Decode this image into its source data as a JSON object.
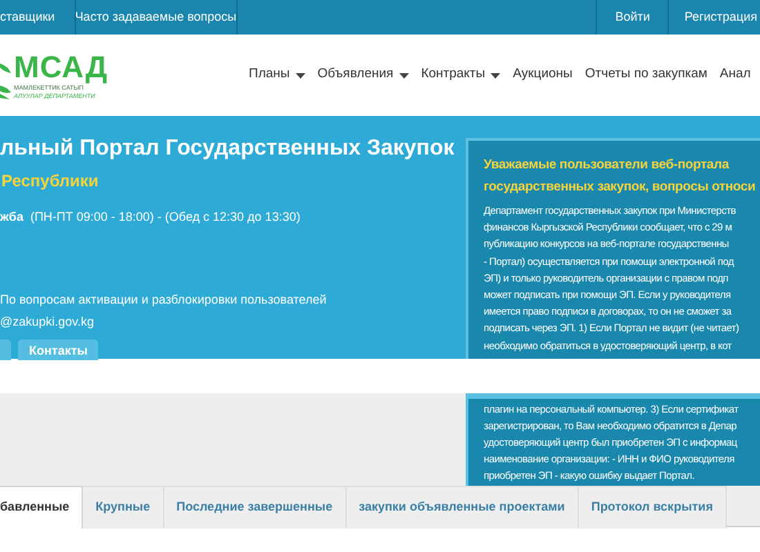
{
  "top_bar": {
    "left_links": [
      "ставщики",
      "Часто задаваемые вопросы"
    ],
    "right_links": [
      "Войти",
      "Регистрация"
    ]
  },
  "header": {
    "logo": {
      "name": "МСАД",
      "subtitle_lines": [
        "МАМЛЕКЕТТИК САТЫП",
        "АЛУУЛАР ДЕПАРТАМЕНТИ"
      ]
    },
    "nav": [
      {
        "label": "Планы",
        "dropdown": true
      },
      {
        "label": "Объявления",
        "dropdown": true
      },
      {
        "label": "Контракты",
        "dropdown": true
      },
      {
        "label": "Аукционы",
        "dropdown": false
      },
      {
        "label": "Отчеты по закупкам",
        "dropdown": false
      },
      {
        "label": "Анал",
        "dropdown": false
      }
    ]
  },
  "hero": {
    "title": "льный Портал Государственных Закупок",
    "subtitle": "Республики",
    "hours": "**жба**  (ПН-ПТ 09:00 - 18:00) - (Обед с 12:30 до 13:30)",
    "contact_lines": [
      "По вопросам активации и разблокировки пользователей",
      "@zakupki.gov.kg"
    ],
    "buttons": [
      {
        "kind": "partial"
      },
      {
        "kind": "full",
        "label": "Контакты"
      }
    ]
  },
  "notice": {
    "title_lines": [
      "Уважаемые пользователи веб-портала",
      "государственных закупок, вопросы относи"
    ],
    "body_upper": [
      "Департамент государственных закупок при Министерств",
      "финансов Кыргызской Республики сообщает, что с 29 м",
      "публикацию конкурсов на веб-портале государственны",
      "- Портал) осуществляется при помощи электронной под",
      "ЭП) и только руководитель организации с правом подп",
      "может подписать при помощи ЭП. Если у руководителя",
      "имеется право подписи в договорах, то он не сможет за",
      "подписать через ЭП. 1) Если Портал не видит (не читает)",
      "необходимо обратиться в удостоверяющий центр, в кот"
    ],
    "body_lower": [
      "плагин на персональный компьютер. 3) Если сертификат",
      "зарегистрирован, то Вам необходимо обратится в Депар",
      "удостоверяющий центр был приобретен ЭП с информац",
      "наименование организации: - ИНН и ФИО руководителя",
      "приобретен ЭП - какую ошибку выдает Портал."
    ]
  },
  "tabs": [
    {
      "label": "бавленные",
      "selected": true
    },
    {
      "label": "Крупные",
      "selected": false
    },
    {
      "label": "Последние завершенные",
      "selected": false
    },
    {
      "label": "закупки объявленные проектами",
      "selected": false
    },
    {
      "label": "Протокол вскрытия",
      "selected": false
    }
  ]
}
